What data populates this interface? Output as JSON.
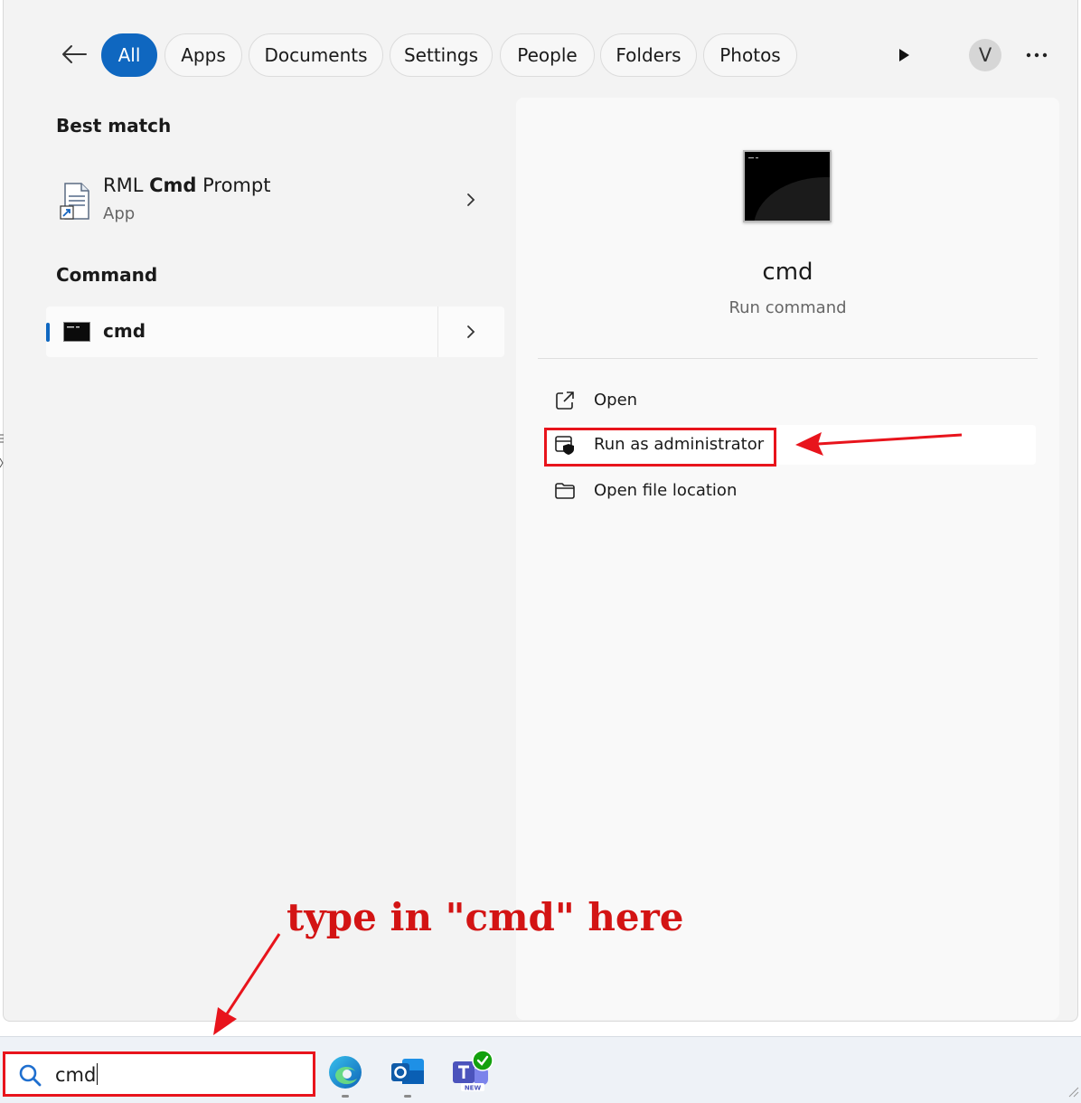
{
  "filters": {
    "tabs": [
      {
        "label": "All",
        "active": true
      },
      {
        "label": "Apps"
      },
      {
        "label": "Documents"
      },
      {
        "label": "Settings"
      },
      {
        "label": "People"
      },
      {
        "label": "Folders"
      },
      {
        "label": "Photos"
      }
    ],
    "avatar_initial": "V"
  },
  "results": {
    "best_match_heading": "Best match",
    "best_match": {
      "title_prefix": "RML ",
      "title_bold": "Cmd",
      "title_suffix": " Prompt",
      "subtitle": "App",
      "icon": "document-shortcut-icon"
    },
    "command_heading": "Command",
    "command_item": {
      "label": "cmd",
      "icon": "console-icon"
    }
  },
  "detail": {
    "name": "cmd",
    "type": "Run command",
    "actions": [
      {
        "label": "Open",
        "icon": "open-external-icon"
      },
      {
        "label": "Run as administrator",
        "icon": "shield-admin-icon",
        "highlighted": true
      },
      {
        "label": "Open file location",
        "icon": "folder-icon"
      }
    ]
  },
  "annotation": {
    "text": "type in \"cmd\" here",
    "color": "#d31414"
  },
  "taskbar": {
    "search_value": "cmd",
    "apps": [
      "edge-icon",
      "outlook-icon",
      "teams-new-icon"
    ],
    "teams_badge": "NEW"
  },
  "colors": {
    "accent": "#0f67c0",
    "highlight_red": "#e8141c"
  }
}
